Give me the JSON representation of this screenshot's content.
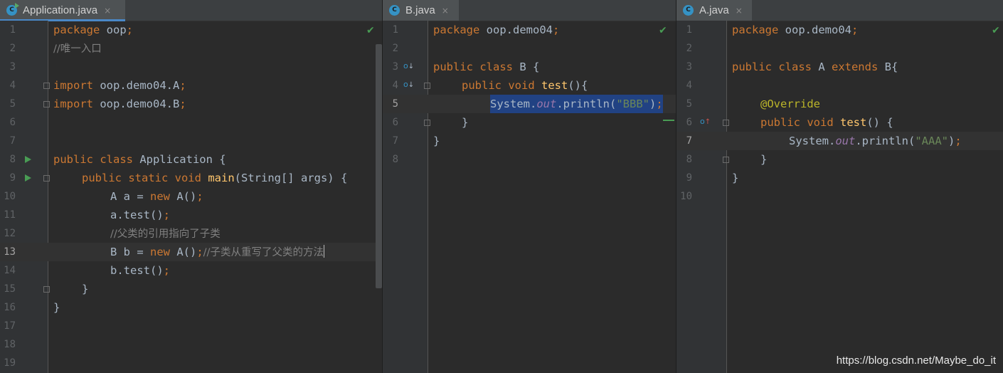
{
  "tabs": {
    "application": {
      "label": "Application.java",
      "close": "×",
      "icon_letter": "C"
    },
    "b": {
      "label": "B.java",
      "close": "×",
      "icon_letter": "C"
    },
    "a": {
      "label": "A.java",
      "close": "×",
      "icon_letter": "C"
    }
  },
  "line_numbers": {
    "application": [
      "1",
      "2",
      "3",
      "4",
      "5",
      "6",
      "7",
      "8",
      "9",
      "10",
      "11",
      "12",
      "13",
      "14",
      "15",
      "16",
      "17",
      "18",
      "19"
    ],
    "b": [
      "1",
      "2",
      "3",
      "4",
      "5",
      "6",
      "7",
      "8"
    ],
    "a": [
      "1",
      "2",
      "3",
      "4",
      "5",
      "6",
      "7",
      "8",
      "9",
      "10"
    ]
  },
  "application_code": {
    "l1_kw": "package",
    "l1_rest": " oop",
    "l1_semi": ";",
    "l2_comment": "//唯一入口",
    "l4_kw": "import",
    "l4_rest": " oop.demo04.A",
    "l4_semi": ";",
    "l5_kw": "import",
    "l5_rest": " oop.demo04.B",
    "l5_semi": ";",
    "l8_kw": "public class",
    "l8_rest": " Application {",
    "l9_kw": "public static void",
    "l9_fn": "main",
    "l9_rest": "(String[] args) {",
    "l10_a": "A a = ",
    "l10_kw": "new",
    "l10_b": " A()",
    "l10_semi": ";",
    "l11_code": "a.test()",
    "l11_semi": ";",
    "l12_comment": "//父类的引用指向了子类",
    "l13_a": "B b = ",
    "l13_kw": "new",
    "l13_b": " A()",
    "l13_semi": ";",
    "l13_comment": "//子类从重写了父类的方法",
    "l14_code": "b.test()",
    "l14_semi": ";",
    "l15": "}",
    "l16": "}"
  },
  "b_code": {
    "l1_kw": "package",
    "l1_rest": " oop.demo04",
    "l1_semi": ";",
    "l3_kw": "public class",
    "l3_rest": " B {",
    "l4_kw": "public void",
    "l4_fn": "test",
    "l4_rest": "(){",
    "l5_a": "System.",
    "l5_field": "out",
    "l5_b": ".println(",
    "l5_str": "\"BBB\"",
    "l5_c": ")",
    "l5_semi": ";",
    "l6": "}",
    "l7": "}"
  },
  "a_code": {
    "l1_kw": "package",
    "l1_rest": " oop.demo04",
    "l1_semi": ";",
    "l3_kw": "public class",
    "l3_rest1": " A ",
    "l3_kw2": "extends",
    "l3_rest2": " B{",
    "l5_ann": "@Override",
    "l6_kw": "public void",
    "l6_fn": "test",
    "l6_rest": "() {",
    "l7_a": "System.",
    "l7_field": "out",
    "l7_b": ".println(",
    "l7_str": "\"AAA\"",
    "l7_c": ")",
    "l7_semi": ";",
    "l8": "}",
    "l9": "}"
  },
  "status_icons": {
    "check": "✔",
    "override_up": "↑",
    "override_down": "↓",
    "override_letter": "o"
  },
  "watermark": "https://blog.csdn.net/Maybe_do_it",
  "colors": {
    "keyword": "#cc7832",
    "function": "#ffc66d",
    "string": "#6a8759",
    "comment": "#808080",
    "field": "#9876aa",
    "annotation": "#bbb529",
    "selection": "#214283",
    "tab_active": "#4a88c7"
  }
}
